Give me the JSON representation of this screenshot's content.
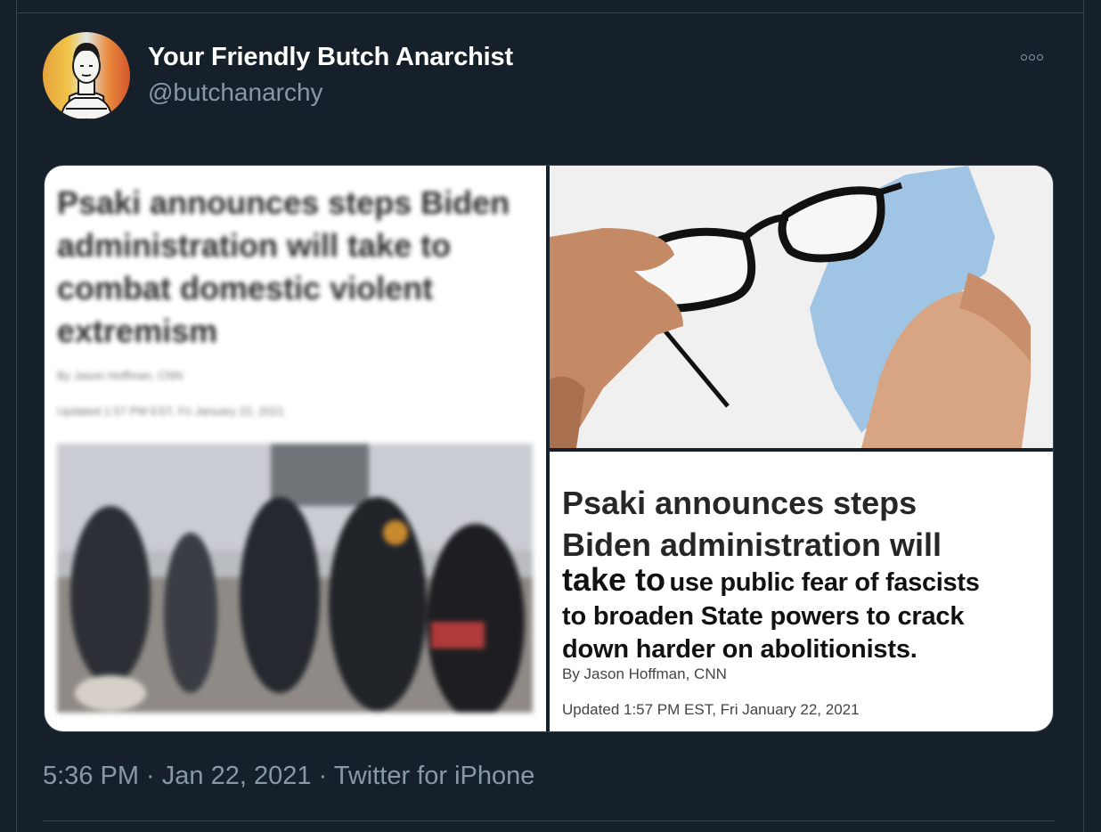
{
  "tweet": {
    "display_name": "Your Friendly Butch Anarchist",
    "handle": "@butchanarchy",
    "more_icon": "more-options-icon"
  },
  "left_image": {
    "headline": "Psaki announces steps Biden administration will take to combat domestic violent extremism",
    "byline": "By Jason Hoffman, CNN",
    "updated": "Updated 1:57 PM EST, Fri January 22, 2021"
  },
  "right_image": {
    "headline_line1": "Psaki announces steps",
    "headline_line2": "Biden administration will",
    "headline_take": "take to",
    "headline_edit_1": "use public fear of fascists",
    "headline_edit_2": "to broaden State powers to crack",
    "headline_edit_3": "down harder on abolitionists.",
    "byline": "By Jason Hoffman, CNN",
    "updated": "Updated 1:57 PM EST, Fri January 22, 2021"
  },
  "footer": {
    "meta": "5:36 PM · Jan 22, 2021 · Twitter for iPhone"
  }
}
